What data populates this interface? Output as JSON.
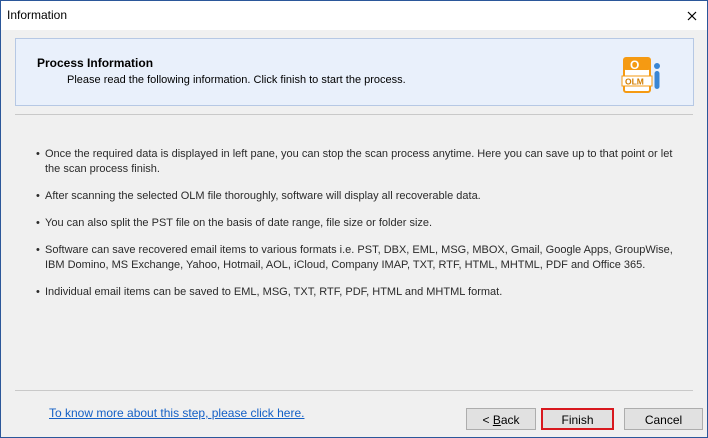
{
  "window": {
    "title": "Information",
    "close_glyph": "×"
  },
  "header": {
    "title": "Process Information",
    "subtitle": "Please read the following information. Click finish to start the process.",
    "logo_icon": "olm-file-icon",
    "logo_text": "OLM",
    "logo_letter": "O"
  },
  "info": {
    "bullet": "•",
    "items": [
      "Once the required data is displayed in left pane, you can stop the scan process anytime. Here you can save up to that point or let the scan process finish.",
      "After scanning the selected OLM file thoroughly, software will display all recoverable data.",
      "You can also split the PST file on the basis of date range, file size or folder size.",
      "Software can save recovered email items to various formats i.e. PST, DBX, EML, MSG, MBOX, Gmail, Google Apps, GroupWise, IBM Domino, MS Exchange, Yahoo, Hotmail, AOL, iCloud, Company IMAP, TXT, RTF, HTML, MHTML, PDF and Office 365.",
      "Individual email items can be saved to EML, MSG, TXT, RTF, PDF, HTML and MHTML format."
    ]
  },
  "footer": {
    "help_link": "To know more about this step, please click here.",
    "back_prefix": "< ",
    "back_mnemonic": "B",
    "back_rest": "ack",
    "finish_label": "Finish",
    "cancel_label": "Cancel"
  },
  "colors": {
    "window_border": "#2b579a",
    "header_bg": "#e9f0fb",
    "link": "#1460c6",
    "finish_highlight": "#d8191f",
    "logo_orange": "#f59a12",
    "logo_blue": "#3a86d4"
  }
}
